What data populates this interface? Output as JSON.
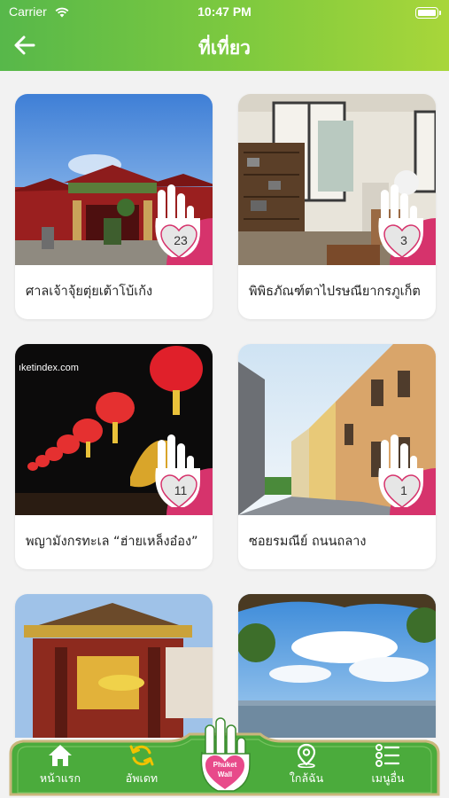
{
  "status_bar": {
    "carrier": "Carrier",
    "time": "10:47 PM"
  },
  "header": {
    "title": "ที่เที่ยว"
  },
  "places": [
    {
      "name": "ศาลเจ้าจุ้ยตุ่ยเต้าโบ้เก้ง",
      "count": "23"
    },
    {
      "name": "พิพิธภัณฑ์ตาไปรษณียากรภูเก็ต",
      "count": "3"
    },
    {
      "name": "พญามังกรทะเล “ฮ่ายเหล็งอ๋อง”",
      "count": "11",
      "watermark": "ıketindex.com"
    },
    {
      "name": "ซอยรมณีย์ ถนนถลาง",
      "count": "1"
    },
    {
      "name": "",
      "count": ""
    },
    {
      "name": "",
      "count": ""
    }
  ],
  "bottom_nav": {
    "home": "หน้าแรก",
    "update": "อัพเดท",
    "logo_line1": "Phuket",
    "logo_line2": "Wall",
    "nearby": "ใกล้ฉัน",
    "more": "เมนูอื่น"
  },
  "colors": {
    "header_start": "#57b84a",
    "header_end": "#a8d63a",
    "badge": "#d6336c",
    "nav_green": "#4bab3c"
  }
}
